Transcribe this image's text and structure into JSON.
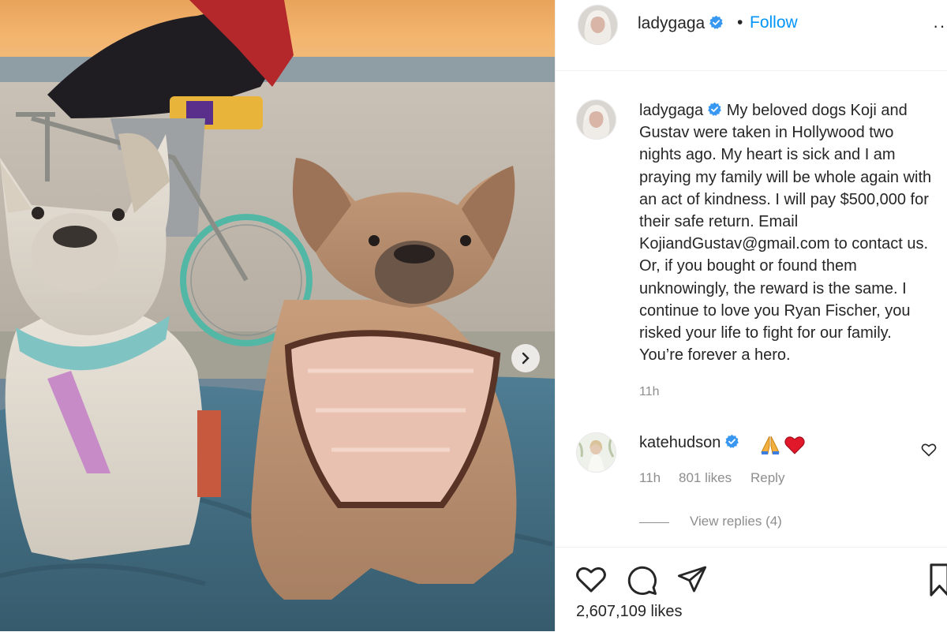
{
  "post": {
    "author": "ladygaga",
    "follow_label": "Follow",
    "separator": "•",
    "more_label": "···",
    "caption_author": "ladygaga",
    "caption_text": "My beloved dogs Koji and Gustav were taken in Hollywood two nights ago. My heart is sick and I am praying my family will be whole again with an act of kindness. I will pay $500,000 for their safe return. Email KojiandGustav@gmail.com to contact us. Or, if you bought or found them unknowingly, the reward is the same. I continue to love you Ryan Fischer, you risked your life to fight for our family. You’re forever a hero.",
    "caption_time": "11h",
    "likes": "2,607,109 likes"
  },
  "comment": {
    "author": "katehudson",
    "emoji": [
      "folded-hands-icon",
      "red-heart-icon"
    ],
    "time": "11h",
    "likes": "801 likes",
    "reply_label": "Reply",
    "view_replies_label": "View replies (4)"
  },
  "icons": {
    "verified": "verified-badge-icon",
    "carousel_next": "chevron-right-icon",
    "like": "heart-icon",
    "comment": "comment-icon",
    "share": "paper-plane-icon",
    "save": "bookmark-icon"
  },
  "colors": {
    "link_blue": "#0095f6",
    "verified_blue": "#3897f0",
    "muted_text": "#8e8e8e",
    "primary_text": "#262626",
    "divider": "#efefef",
    "heart_red": "#e0182a"
  }
}
